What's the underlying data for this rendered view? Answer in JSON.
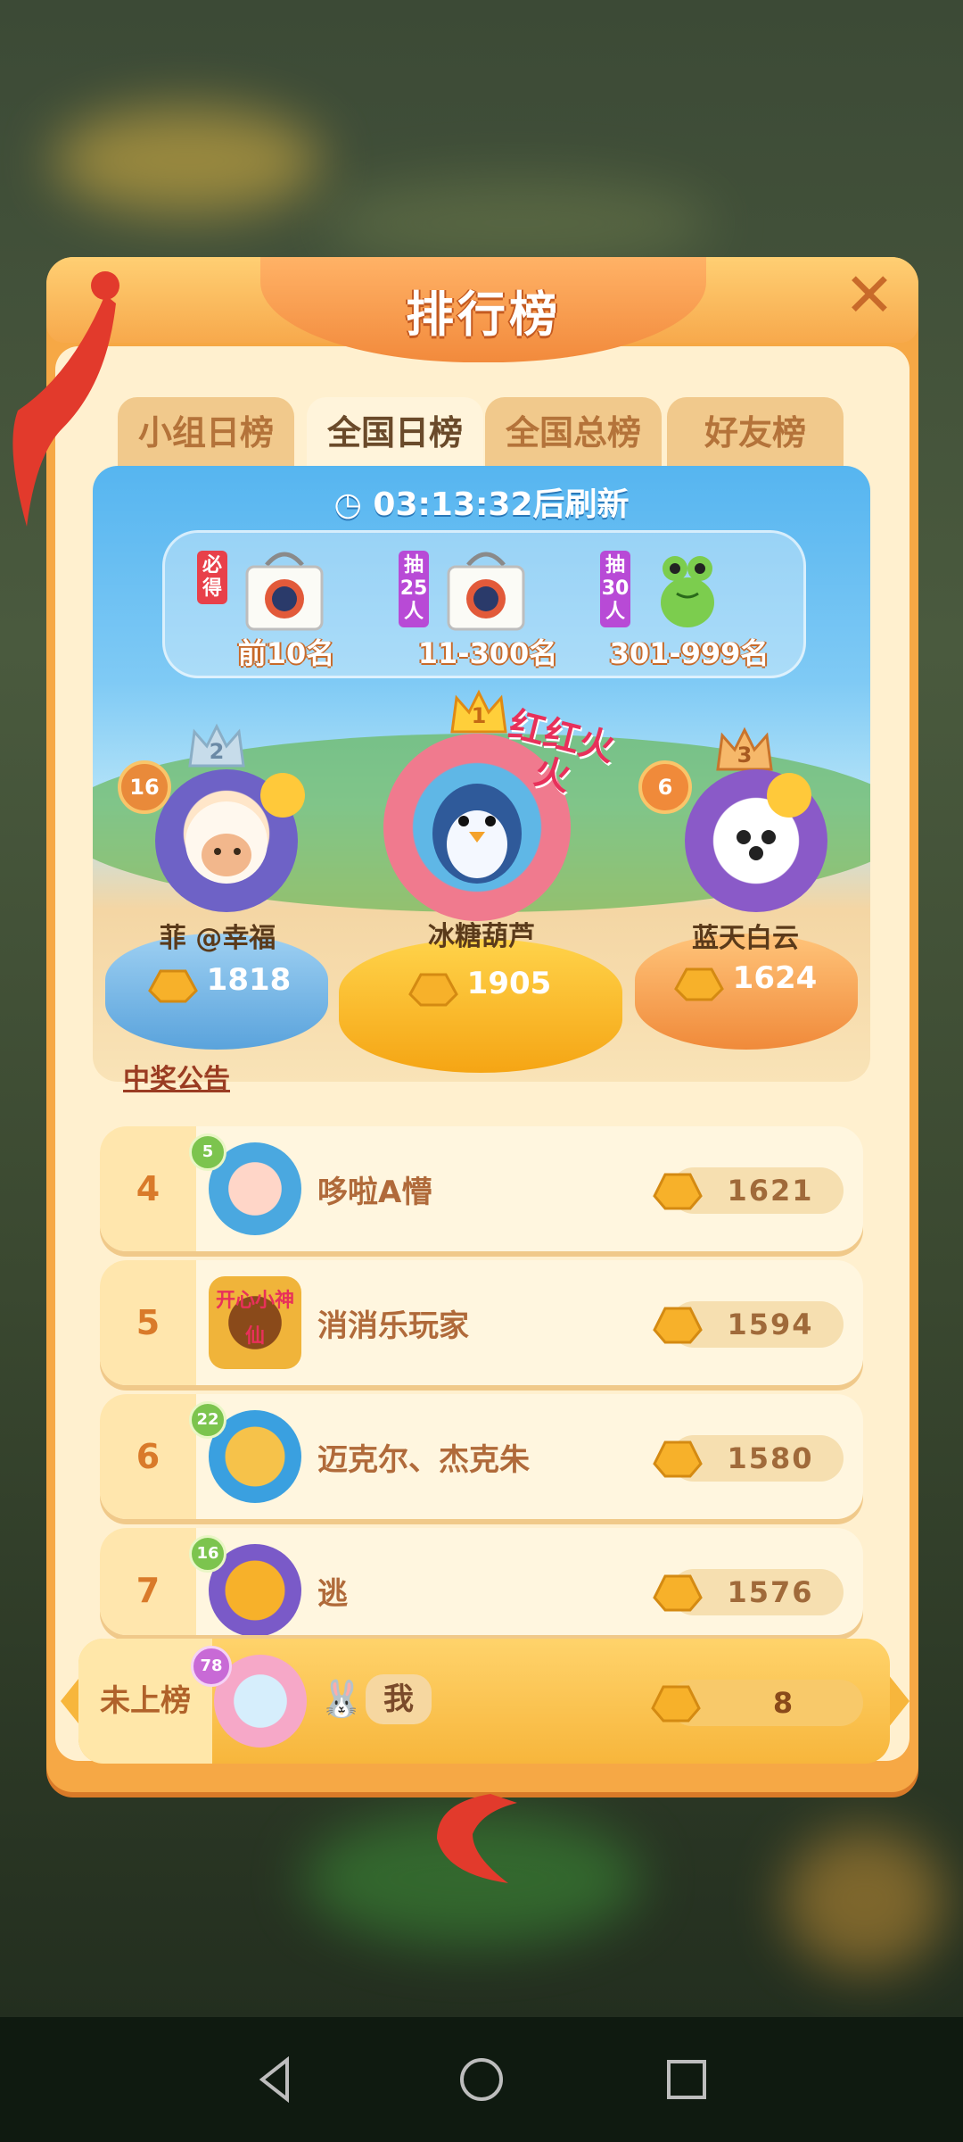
{
  "panel": {
    "title": "排行榜"
  },
  "tabs": [
    {
      "label": "小组日榜",
      "active": false
    },
    {
      "label": "全国日榜",
      "active": true
    },
    {
      "label": "全国总榜",
      "active": false
    },
    {
      "label": "好友榜",
      "active": false
    }
  ],
  "timer": {
    "time": "03:13:32",
    "suffix": "后刷新"
  },
  "prizes": [
    {
      "tag": "必得",
      "range": "前10名"
    },
    {
      "tag": "抽25人",
      "range": "11-300名"
    },
    {
      "tag": "抽30人",
      "range": "301-999名"
    }
  ],
  "podium": {
    "first": {
      "rank": "1",
      "name": "冰糖葫芦",
      "score": "1905",
      "badge_text": "红红火火"
    },
    "second": {
      "rank": "2",
      "name": "菲 @幸福",
      "score": "1818",
      "level": "16"
    },
    "third": {
      "rank": "3",
      "name": "蓝天白云",
      "score": "1624",
      "level": "6"
    }
  },
  "notice": "中奖公告",
  "rows": [
    {
      "rank": "4",
      "name": "哆啦A懵",
      "score": "1621",
      "level": "5"
    },
    {
      "rank": "5",
      "name": "消消乐玩家",
      "score": "1594",
      "level": ""
    },
    {
      "rank": "6",
      "name": "迈克尔、杰克朱",
      "score": "1580",
      "level": "22"
    },
    {
      "rank": "7",
      "name": "逃",
      "score": "1576",
      "level": "16"
    }
  ],
  "me": {
    "rank_label": "未上榜",
    "name": "我",
    "score": "8",
    "level": "78"
  },
  "avatar_text": {
    "fifth": "开心小神仙"
  },
  "colors": {
    "accent": "#f6a845",
    "gold": "#f7b63c",
    "rank_text": "#d97a2a"
  }
}
